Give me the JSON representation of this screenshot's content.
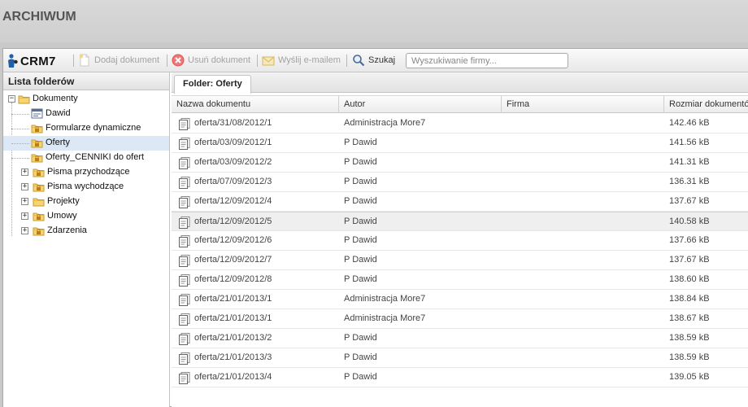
{
  "page": {
    "title": "ARCHIWUM"
  },
  "toolbar": {
    "logo": "CRM7",
    "add_document": "Dodaj dokument",
    "delete_document": "Usuń dokument",
    "send_email": "Wyślij e-mailem",
    "search": "Szukaj",
    "search_placeholder": "Wyszukiwanie firmy..."
  },
  "sidebar": {
    "title": "Lista folderów",
    "root": "Dokumenty",
    "items": [
      {
        "label": "Dawid",
        "icon": "form-icon",
        "expandable": false
      },
      {
        "label": "Formularze dynamiczne",
        "icon": "locked-folder-icon",
        "expandable": false
      },
      {
        "label": "Oferty",
        "icon": "locked-folder-icon",
        "expandable": false,
        "selected": true
      },
      {
        "label": "Oferty_CENNIKI do ofert",
        "icon": "locked-folder-icon",
        "expandable": false
      },
      {
        "label": "Pisma przychodzące",
        "icon": "locked-folder-icon",
        "expandable": true
      },
      {
        "label": "Pisma wychodzące",
        "icon": "locked-folder-icon",
        "expandable": true
      },
      {
        "label": "Projekty",
        "icon": "folder-icon",
        "expandable": true
      },
      {
        "label": "Umowy",
        "icon": "locked-folder-icon",
        "expandable": true
      },
      {
        "label": "Zdarzenia",
        "icon": "locked-folder-icon",
        "expandable": true
      }
    ]
  },
  "main": {
    "tab": "Folder: Oferty",
    "columns": [
      "Nazwa dokumentu",
      "Autor",
      "Firma",
      "Rozmiar dokumentów"
    ],
    "rows": [
      [
        "oferta/31/08/2012/1",
        "Administracja More7",
        "",
        "142.46 kB"
      ],
      [
        "oferta/03/09/2012/1",
        "P Dawid",
        "",
        "141.56 kB"
      ],
      [
        "oferta/03/09/2012/2",
        "P Dawid",
        "",
        "141.31 kB"
      ],
      [
        "oferta/07/09/2012/3",
        "P Dawid",
        "",
        "136.31 kB"
      ],
      [
        "oferta/12/09/2012/4",
        "P Dawid",
        "",
        "137.67 kB"
      ],
      [
        "oferta/12/09/2012/5",
        "P Dawid",
        "",
        "140.58 kB"
      ],
      [
        "oferta/12/09/2012/6",
        "P Dawid",
        "",
        "137.66 kB"
      ],
      [
        "oferta/12/09/2012/7",
        "P Dawid",
        "",
        "137.67 kB"
      ],
      [
        "oferta/12/09/2012/8",
        "P Dawid",
        "",
        "138.60 kB"
      ],
      [
        "oferta/21/01/2013/1",
        "Administracja More7",
        "",
        "138.84 kB"
      ],
      [
        "oferta/21/01/2013/1",
        "Administracja More7",
        "",
        "138.67 kB"
      ],
      [
        "oferta/21/01/2013/2",
        "P Dawid",
        "",
        "138.59 kB"
      ],
      [
        "oferta/21/01/2013/3",
        "P Dawid",
        "",
        "138.59 kB"
      ],
      [
        "oferta/21/01/2013/4",
        "P Dawid",
        "",
        "139.05 kB"
      ]
    ],
    "highlighted_row": 5
  }
}
